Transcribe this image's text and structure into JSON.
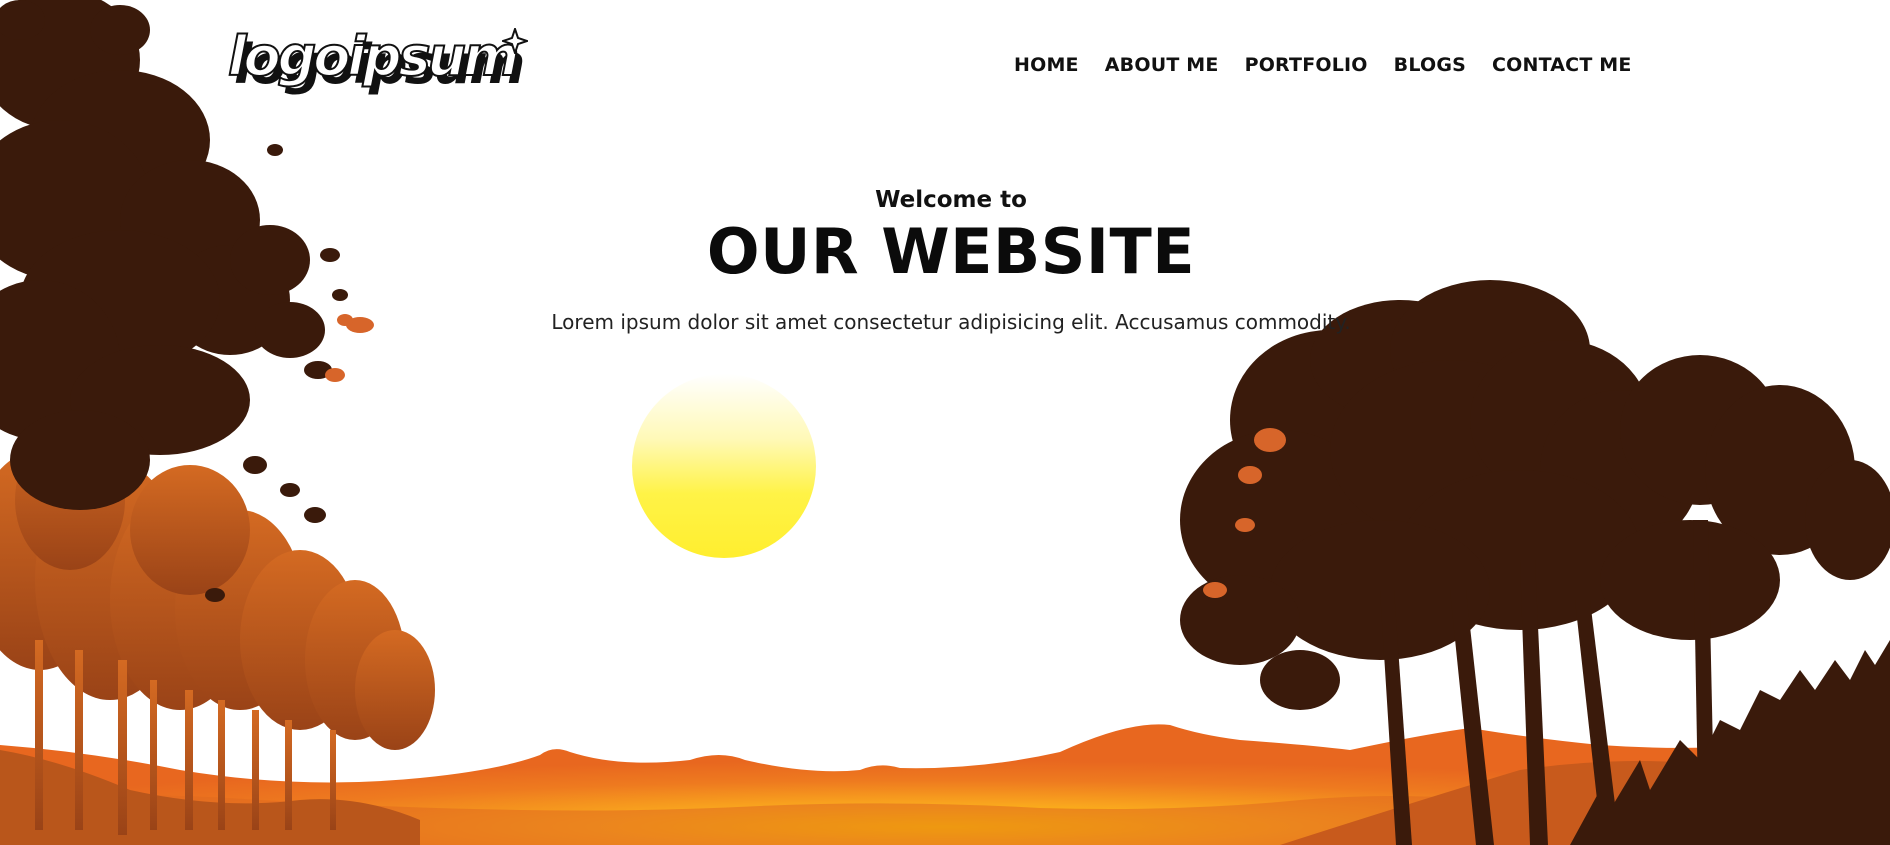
{
  "brand": {
    "logo_text": "logoipsum"
  },
  "nav": {
    "items": [
      {
        "label": "HOME"
      },
      {
        "label": "ABOUT ME"
      },
      {
        "label": "PORTFOLIO"
      },
      {
        "label": "BLOGS"
      },
      {
        "label": "CONTACT ME"
      }
    ]
  },
  "hero": {
    "eyebrow": "Welcome to",
    "title": "OUR WEBSITE",
    "description": "Lorem ipsum dolor sit amet consectetur adipisicing elit. Accusamus commodity."
  },
  "colors": {
    "tree_dark": "#3a1a0b",
    "tree_orange": "#b5521a",
    "hill_orange": "#e8671f",
    "sun_yellow": "#fff23a",
    "glow_yellow": "#ffd000"
  },
  "icons": {
    "logo_sparkle": "sparkle-icon"
  }
}
